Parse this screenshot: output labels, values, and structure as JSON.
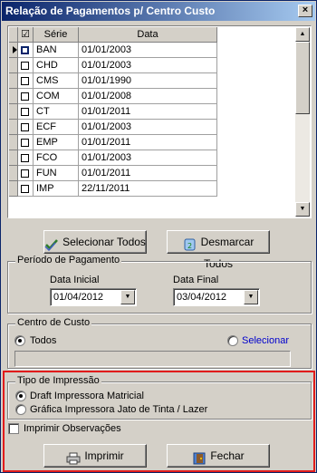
{
  "window": {
    "title": "Relação de Pagamentos p/ Centro Custo",
    "close": "×"
  },
  "grid": {
    "columns": [
      "☑",
      "Série",
      "Data"
    ],
    "rows": [
      {
        "serie": "BAN",
        "data": "01/01/2003"
      },
      {
        "serie": "CHD",
        "data": "01/01/2003"
      },
      {
        "serie": "CMS",
        "data": "01/01/1990"
      },
      {
        "serie": "COM",
        "data": "01/01/2008"
      },
      {
        "serie": "CT",
        "data": "01/01/2011"
      },
      {
        "serie": "ECF",
        "data": "01/01/2003"
      },
      {
        "serie": "EMP",
        "data": "01/01/2011"
      },
      {
        "serie": "FCO",
        "data": "01/01/2003"
      },
      {
        "serie": "FUN",
        "data": "01/01/2011"
      },
      {
        "serie": "IMP",
        "data": "22/11/2011"
      }
    ]
  },
  "buttons": {
    "select_all": "Selecionar Todos",
    "deselect_all": "Desmarcar Todos",
    "print": "Imprimir",
    "close": "Fechar"
  },
  "periodo": {
    "legend": "Período de Pagamento",
    "start_label": "Data Inicial",
    "start_value": "01/04/2012",
    "end_label": "Data Final",
    "end_value": "03/04/2012"
  },
  "centro": {
    "legend": "Centro de Custo",
    "all_label": "Todos",
    "select_label": "Selecionar"
  },
  "impressao": {
    "legend": "Tipo de Impressão",
    "opt1": "Draft Impressora Matricial",
    "opt2": "Gráfica Impressora Jato de Tinta / Lazer"
  },
  "observacoes": {
    "label": "Imprimir Observações"
  },
  "colors": {
    "highlight": "#e11b1b",
    "link": "#0000cc",
    "titlebar": "#0a246a"
  }
}
